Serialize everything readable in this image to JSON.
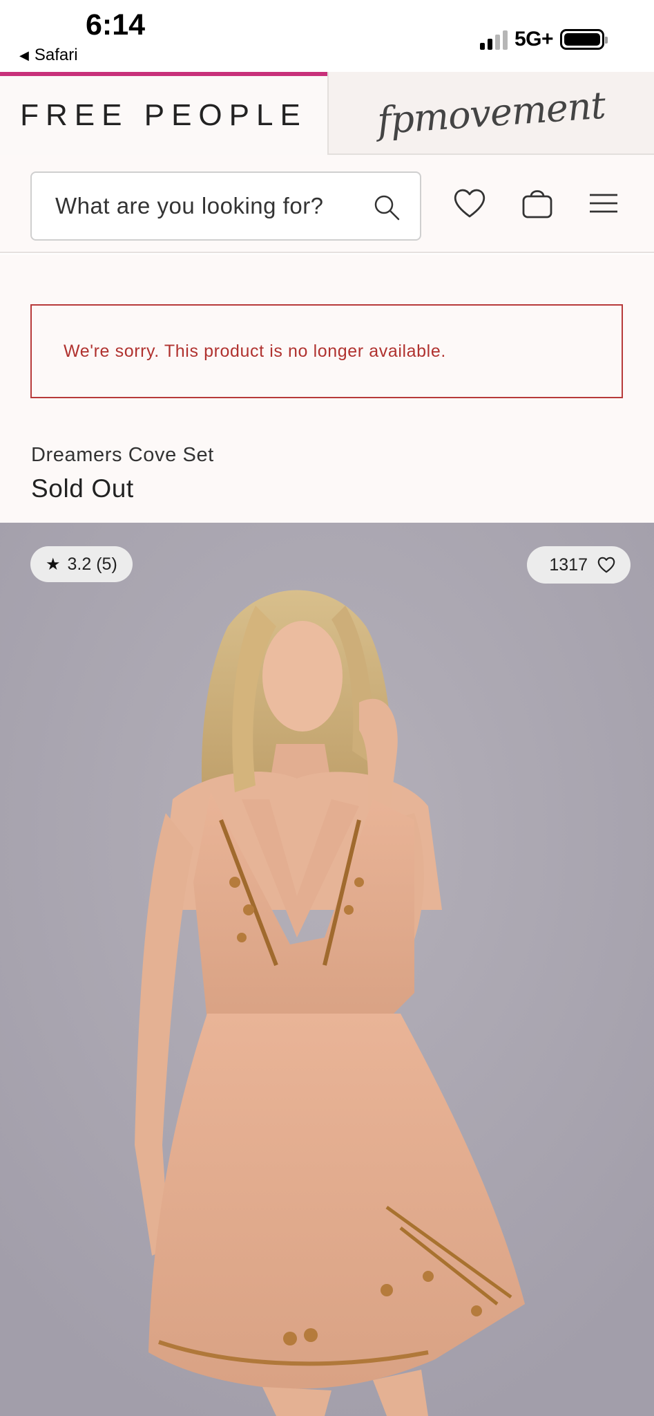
{
  "status_bar": {
    "time": "6:14",
    "back_app": "Safari",
    "network": "5G+"
  },
  "brand_tabs": {
    "primary": "FREE PEOPLE",
    "secondary": "fpmovement",
    "active_color": "#c8317a"
  },
  "search": {
    "placeholder": "What are you looking for?"
  },
  "icons": {
    "search": "search-icon",
    "wishlist": "heart-icon",
    "bag": "shopping-bag-icon",
    "menu": "hamburger-menu-icon",
    "star": "star-icon"
  },
  "alert": {
    "message": "We're sorry. This product is no longer available.",
    "color": "#b0322f"
  },
  "product": {
    "name": "Dreamers Cove Set",
    "status": "Sold Out",
    "rating_text": "3.2 (5)",
    "likes": "1317"
  }
}
